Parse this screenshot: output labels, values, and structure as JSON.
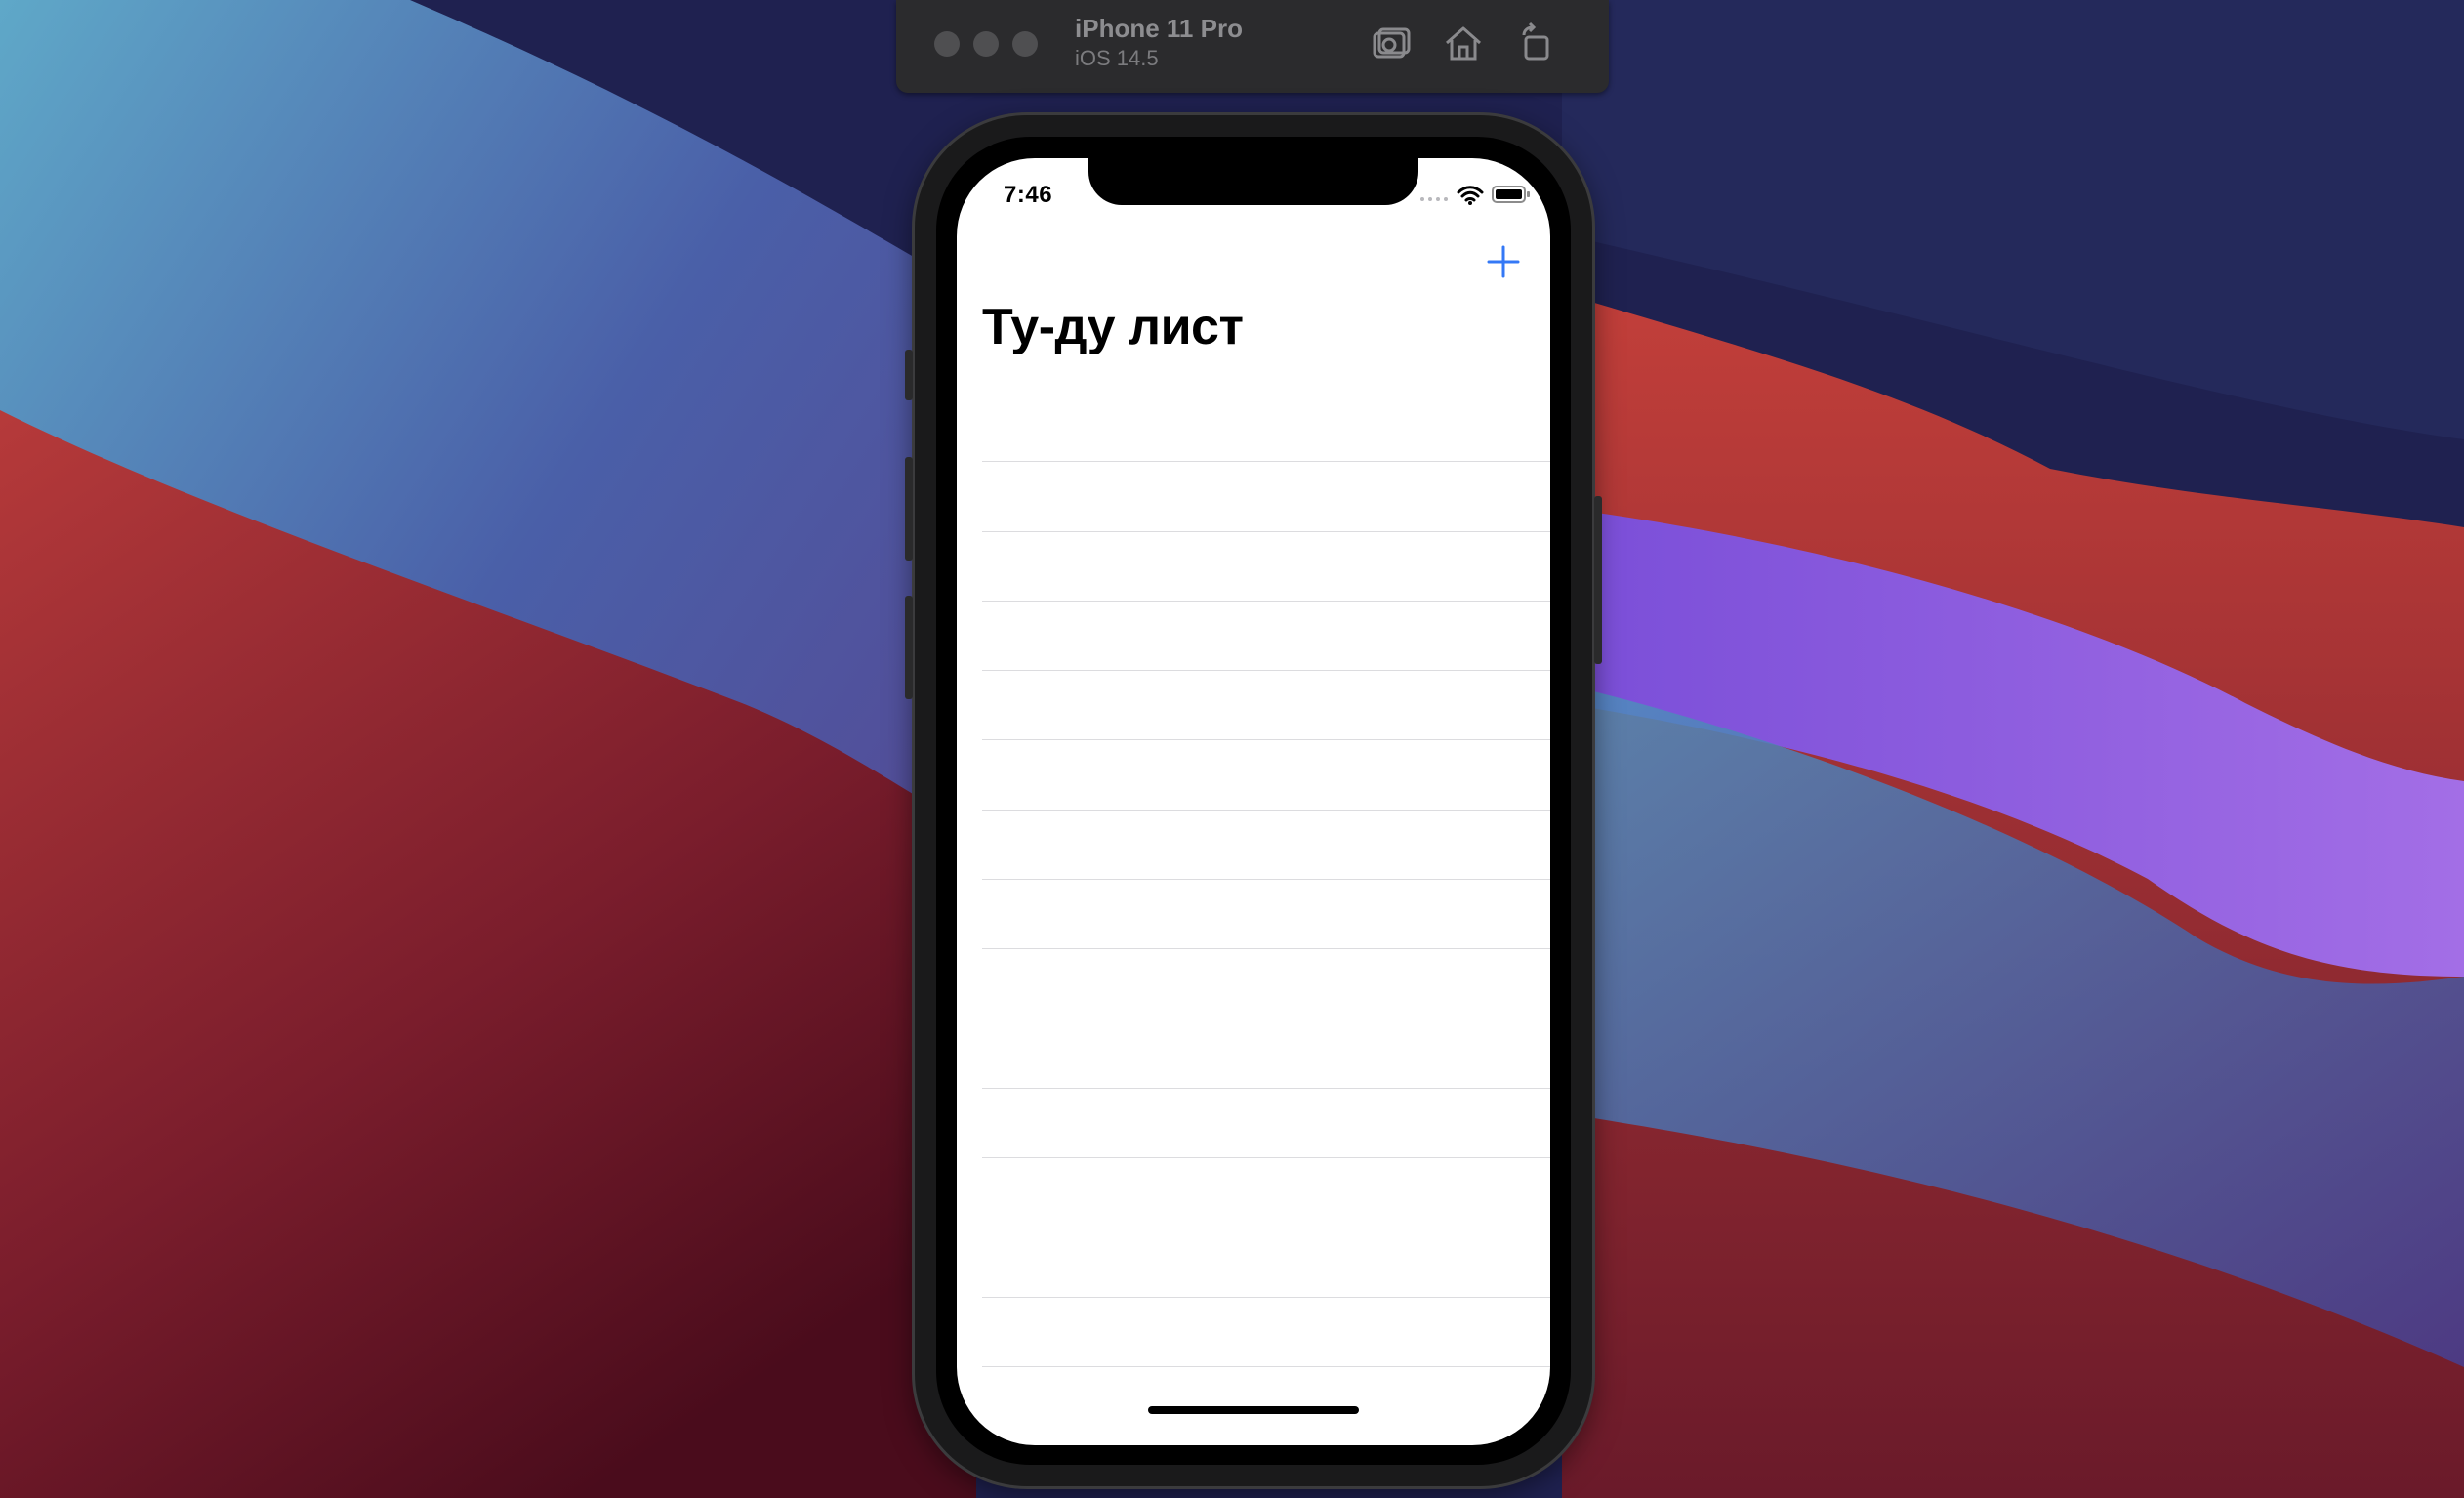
{
  "simulator": {
    "device_name": "iPhone 11 Pro",
    "os_version": "iOS 14.5",
    "toolbar_icons": [
      "screenshot-icon",
      "home-icon",
      "rotate-icon"
    ]
  },
  "status_bar": {
    "time": "7:46",
    "icons": [
      "cellular-dots-icon",
      "wifi-icon",
      "battery-icon"
    ]
  },
  "nav": {
    "title": "Ту-ду лист",
    "add_icon": "plus-icon"
  },
  "list": {
    "rows": [
      "",
      "",
      "",
      "",
      "",
      "",
      "",
      "",
      "",
      "",
      "",
      "",
      "",
      "",
      ""
    ]
  },
  "colors": {
    "accent": "#3478f6",
    "screen_background": "#ffffff",
    "separator": "#dcdcdf"
  }
}
